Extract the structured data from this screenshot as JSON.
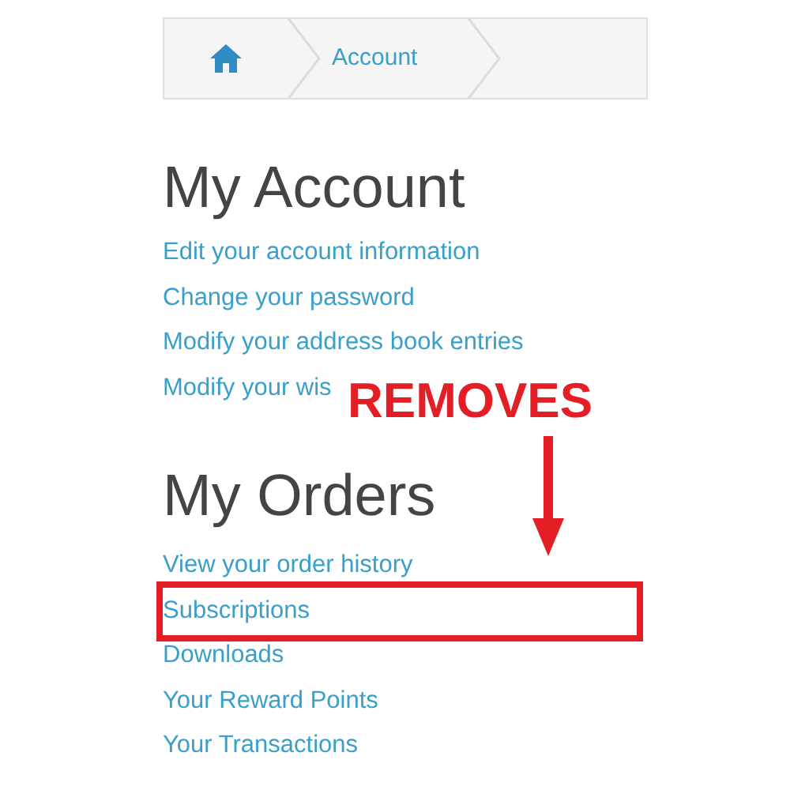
{
  "breadcrumb": [
    {
      "kind": "home"
    },
    {
      "kind": "text",
      "label": "Account"
    }
  ],
  "sections": [
    {
      "title": "My Account",
      "links": [
        "Edit your account information",
        "Change your password",
        "Modify your address book entries",
        "Modify your wis"
      ]
    },
    {
      "title": "My Orders",
      "links": [
        "View your order history",
        "Subscriptions",
        "Downloads",
        "Your Reward Points",
        "Your Transactions"
      ]
    }
  ],
  "annotation": {
    "label": "REMOVES"
  }
}
